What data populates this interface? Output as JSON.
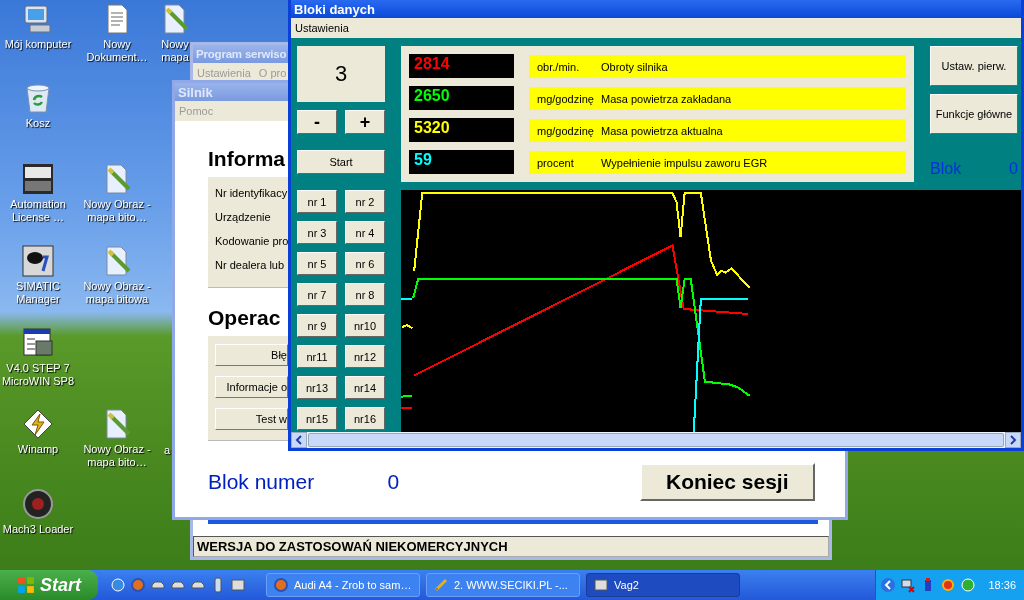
{
  "desktop_icons": [
    {
      "label": "Mój komputer",
      "kind": "computer"
    },
    {
      "label": "Nowy Dokument…",
      "kind": "document"
    },
    {
      "label": "Nowy mapa",
      "kind": "paint"
    },
    {
      "label": "Kosz",
      "kind": "recycle"
    },
    {
      "label": "Automation License …",
      "kind": "license"
    },
    {
      "label": "Nowy Obraz - mapa bito…",
      "kind": "paint"
    },
    {
      "label": "SIMATIC Manager",
      "kind": "simatic"
    },
    {
      "label": "Nowy Obraz - mapa bitowa",
      "kind": "paint"
    },
    {
      "label": "V4.0 STEP 7 MicroWIN SP8",
      "kind": "plc"
    },
    {
      "label": "Winamp",
      "kind": "winamp"
    },
    {
      "label": "Nowy Obraz - mapa bito…",
      "kind": "paint"
    },
    {
      "label": "a",
      "kind": "hidden"
    },
    {
      "label": "Mach3 Loader",
      "kind": "mach3"
    }
  ],
  "program_window": {
    "title": "Program serwiso",
    "menu": [
      "Ustawienia",
      "O pro"
    ],
    "status": "WERSJA DO ZASTOSOWAŃ NIEKOMERCYJNYCH"
  },
  "engine_window": {
    "title": "Silnik",
    "menu": [
      "Pomoc"
    ],
    "info_heading": "Informa",
    "info_rows": [
      "Nr identyfikacy",
      "Urządzenie",
      "Kodowanie pro",
      "Nr dealera lub"
    ],
    "operations_heading": "Operac",
    "operation_buttons": [
      "Błę",
      "Informacje o",
      "Test w"
    ],
    "block_label": "Blok numer",
    "block_value": "0",
    "end_button": "Koniec sesji"
  },
  "data_window": {
    "title": "Bloki danych",
    "menu": [
      "Ustawienia"
    ],
    "group_number": "3",
    "minus": "-",
    "plus": "+",
    "start": "Start",
    "group_buttons": [
      "nr 1",
      "nr 2",
      "nr 3",
      "nr 4",
      "nr 5",
      "nr 6",
      "nr 7",
      "nr 8",
      "nr 9",
      "nr10",
      "nr11",
      "nr12",
      "nr13",
      "nr14",
      "nr15",
      "nr16"
    ],
    "readings": [
      {
        "value": "2814",
        "unit": "obr./min.",
        "name": "Obroty silnika",
        "color": "#ff0000"
      },
      {
        "value": "2650",
        "unit": "mg/godzinę",
        "name": "Masa powietrza zakładana",
        "color": "#00ff00"
      },
      {
        "value": "5320",
        "unit": "mg/godzinę",
        "name": "Masa powietrza aktualna",
        "color": "#ffff00"
      },
      {
        "value": "59",
        "unit": "procent",
        "name": "Wypełnienie impulsu zaworu EGR",
        "color": "#00ffff"
      }
    ],
    "reset_button": "Ustaw. pierw.",
    "main_button": "Funkcje główne",
    "block_label": "Blok",
    "block_value": "0"
  },
  "taskbar": {
    "start": "Start",
    "tasks": [
      {
        "label": "Audi A4 - Zrob to sam…",
        "kind": "browser",
        "selected": false
      },
      {
        "label": "2. WWW.SECIKI.PL -...",
        "kind": "tool",
        "selected": false
      },
      {
        "label": "Vag2",
        "kind": "app",
        "selected": true
      }
    ],
    "clock": "18:36"
  }
}
